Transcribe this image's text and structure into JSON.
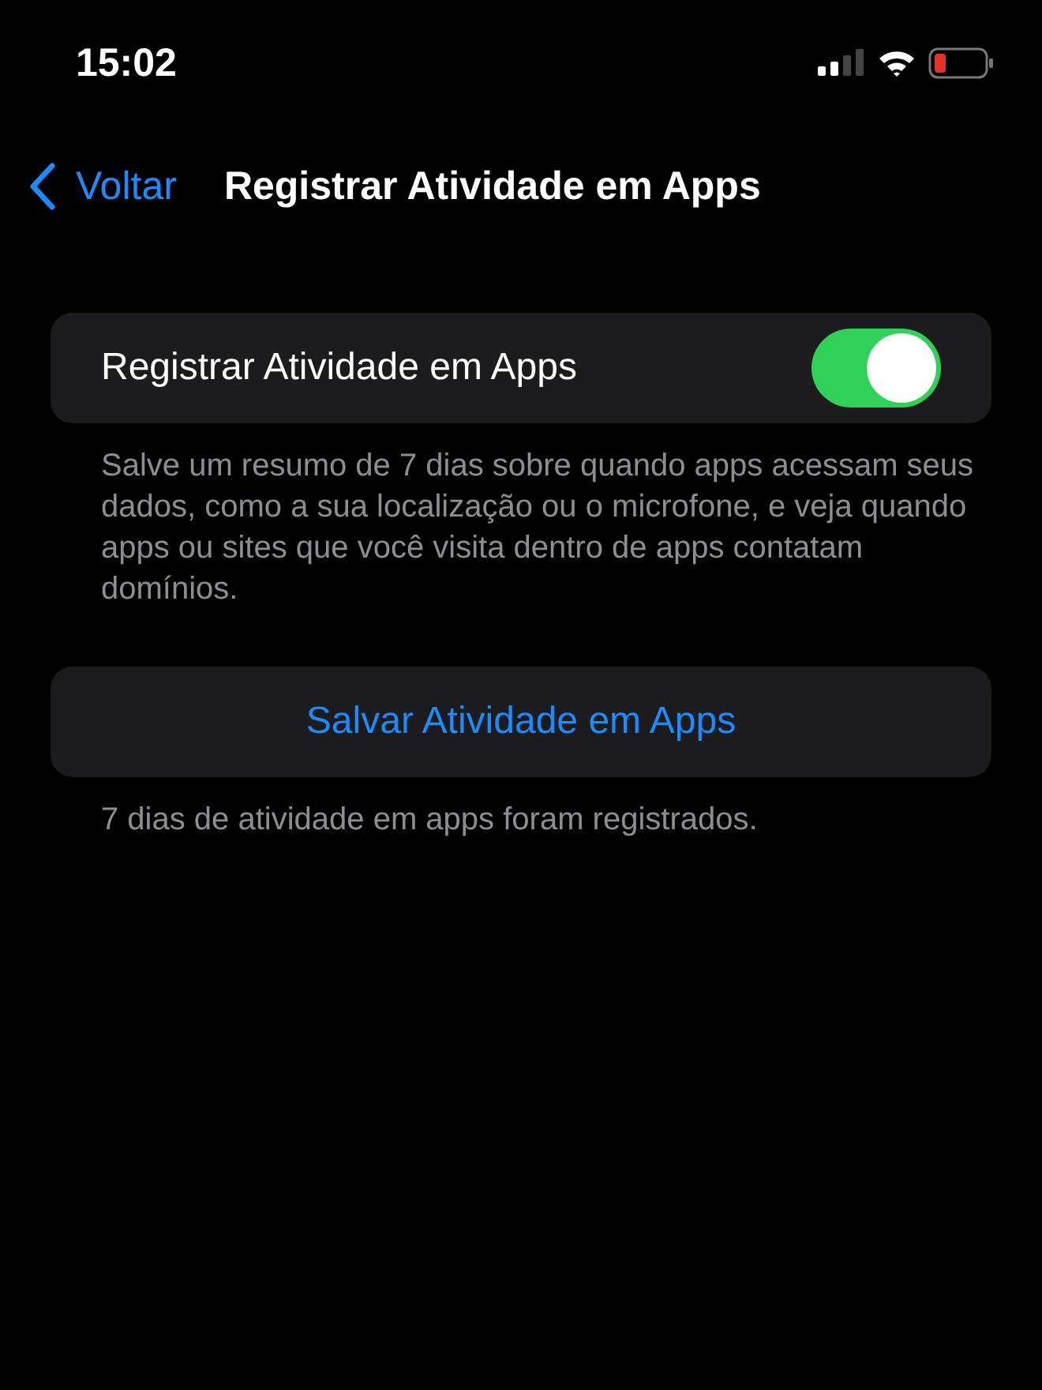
{
  "status_bar": {
    "time": "15:02"
  },
  "nav": {
    "back": "Voltar",
    "title": "Registrar Atividade em Apps"
  },
  "toggle_row": {
    "label": "Registrar Atividade em Apps",
    "on": true
  },
  "toggle_footer": "Salve um resumo de 7 dias sobre quando apps acessam seus dados, como a sua localização ou o microfone, e veja quando apps ou sites que você visita dentro de apps contatam domínios.",
  "action": {
    "label": "Salvar Atividade em Apps"
  },
  "action_footer": "7 dias de atividade em apps foram registrados."
}
